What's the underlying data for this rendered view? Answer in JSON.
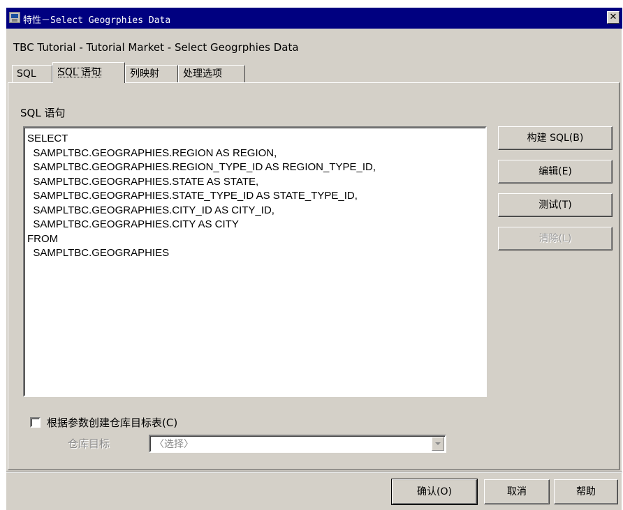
{
  "window": {
    "title": "特性－Select Geogrphies Data",
    "close_glyph": "✕"
  },
  "subtitle": "TBC Tutorial - Tutorial Market - Select Geogrphies Data",
  "tabs": [
    {
      "label": "SQL",
      "active": false
    },
    {
      "label": "SQL 语句",
      "active": true
    },
    {
      "label": "列映射",
      "active": false
    },
    {
      "label": "处理选项",
      "active": false
    }
  ],
  "sql_section": {
    "label": "SQL 语句",
    "statement": "SELECT\n  SAMPLTBC.GEOGRAPHIES.REGION AS REGION,\n  SAMPLTBC.GEOGRAPHIES.REGION_TYPE_ID AS REGION_TYPE_ID,\n  SAMPLTBC.GEOGRAPHIES.STATE AS STATE,\n  SAMPLTBC.GEOGRAPHIES.STATE_TYPE_ID AS STATE_TYPE_ID,\n  SAMPLTBC.GEOGRAPHIES.CITY_ID AS CITY_ID,\n  SAMPLTBC.GEOGRAPHIES.CITY AS CITY\nFROM\n  SAMPLTBC.GEOGRAPHIES"
  },
  "side_buttons": {
    "build_sql": "构建 SQL(B)",
    "edit": "编辑(E)",
    "test": "测试(T)",
    "clear": "清除(L)"
  },
  "create_target": {
    "checkbox_label": "根据参数创建仓库目标表(C)",
    "checked": false,
    "target_label": "仓库目标",
    "target_value": "〈选择〉"
  },
  "footer_buttons": {
    "ok": "确认(O)",
    "cancel": "取消",
    "help": "帮助"
  },
  "colors": {
    "titlebar": "#000080",
    "face": "#d4d0c8",
    "disabled_text": "#8a8a8a"
  }
}
